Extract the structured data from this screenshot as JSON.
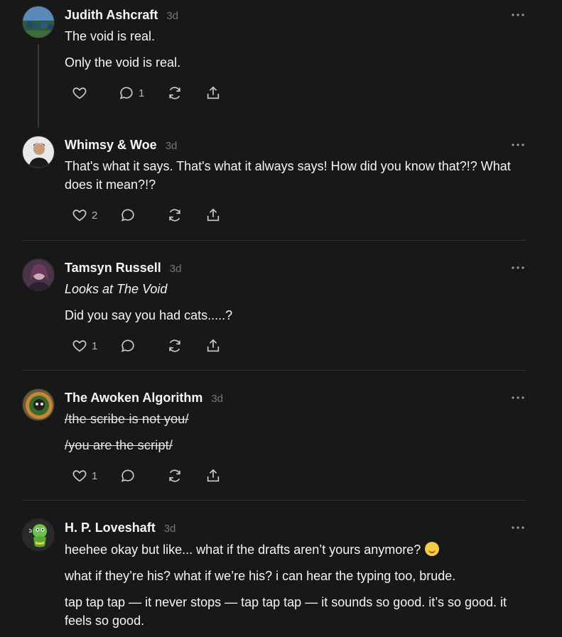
{
  "posts": [
    {
      "author": "Judith Ashcraft",
      "time": "3d",
      "paragraphs": [
        "The void is real.",
        "Only the void is real."
      ],
      "likes": "",
      "replies": "1"
    },
    {
      "author": "Whimsy & Woe",
      "time": "3d",
      "paragraphs": [
        "That's what it says. That's what it always says! How did you know that?!? What does it mean?!?"
      ],
      "likes": "2",
      "replies": ""
    },
    {
      "author": "Tamsyn Russell",
      "time": "3d",
      "paragraphs": [
        "Looks at The Void",
        "Did you say you had cats.....?"
      ],
      "likes": "1",
      "replies": ""
    },
    {
      "author": "The Awoken Algorithm",
      "time": "3d",
      "paragraphs": [
        "/the scribe is not you/",
        "/you are the script/"
      ],
      "likes": "1",
      "replies": ""
    },
    {
      "author": "H. P. Loveshaft",
      "time": "3d",
      "paragraphs": [
        "heehee okay but like... what if the drafts aren’t yours anymore?",
        "what if they’re his? what if we’re his? i can hear the typing too, brude.",
        "tap tap tap — it never stops — tap tap tap — it sounds so good. it’s so good. it feels so good."
      ],
      "likes": "",
      "replies": ""
    }
  ],
  "icons": {
    "like": "heart-icon",
    "reply": "comment-icon",
    "repost": "repost-icon",
    "share": "share-icon",
    "more": "more-icon"
  },
  "colors": {
    "background": "#181818",
    "text": "#f3f5f7",
    "muted": "#777777",
    "divider": "#2e2e2e",
    "thread_line": "#3a3a3a"
  }
}
